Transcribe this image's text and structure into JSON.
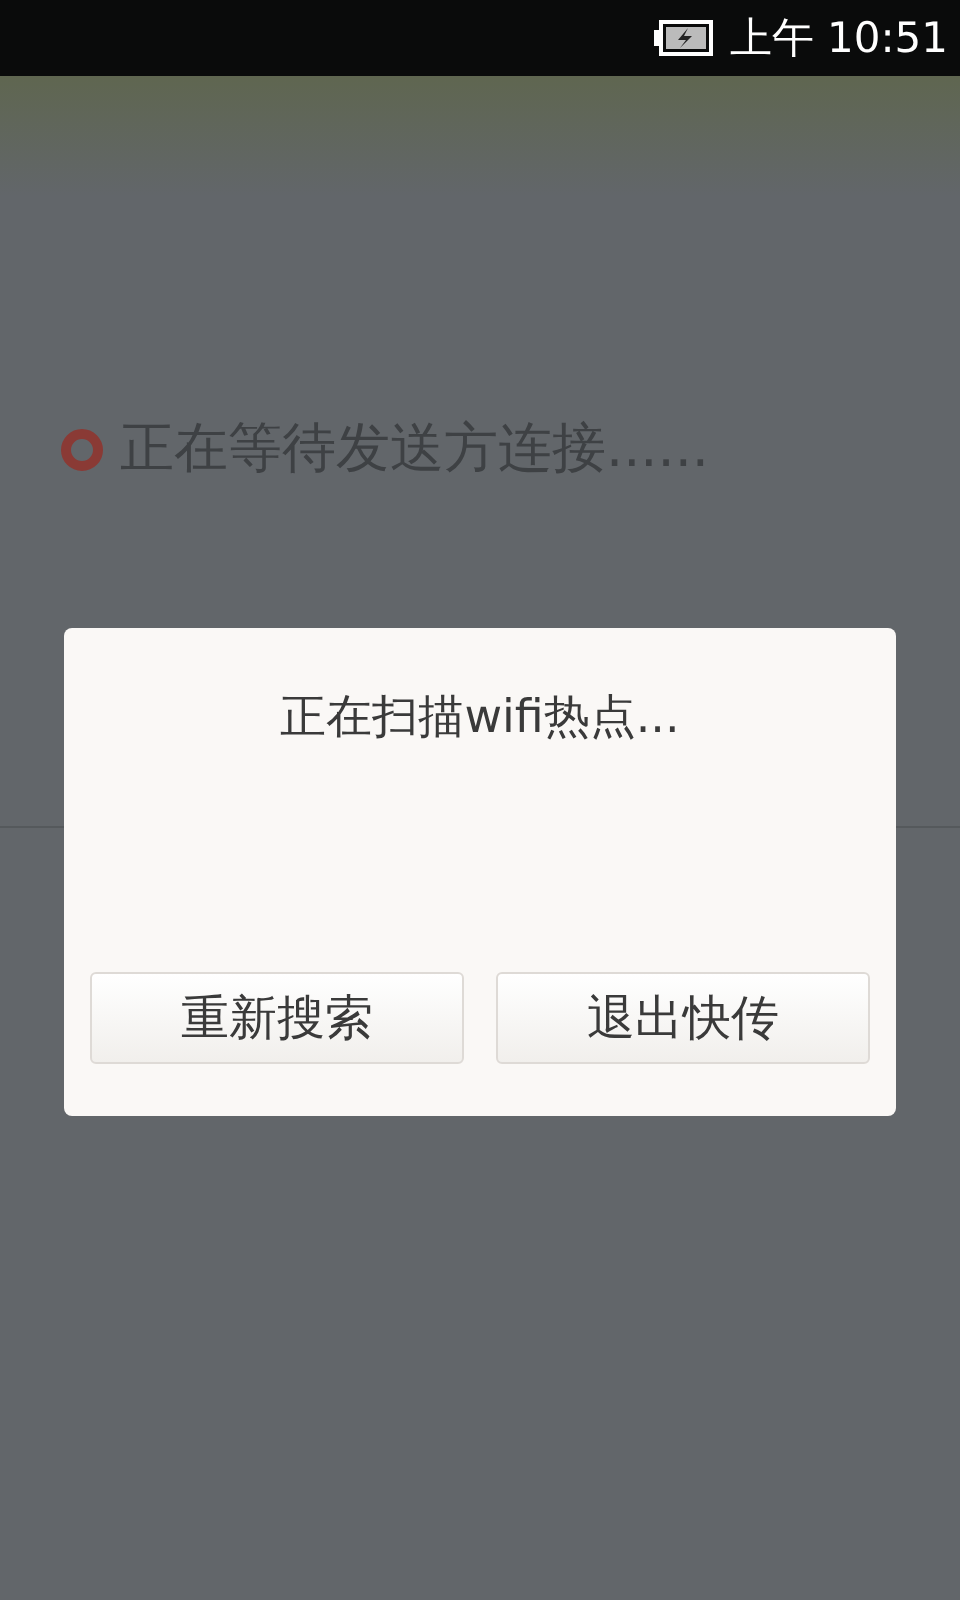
{
  "status_bar": {
    "time": "上午 10:51"
  },
  "background": {
    "status_text": "正在等待发送方连接......"
  },
  "dialog": {
    "message": "正在扫描wifi热点...",
    "buttons": [
      "重新搜索",
      "退出快传"
    ]
  }
}
